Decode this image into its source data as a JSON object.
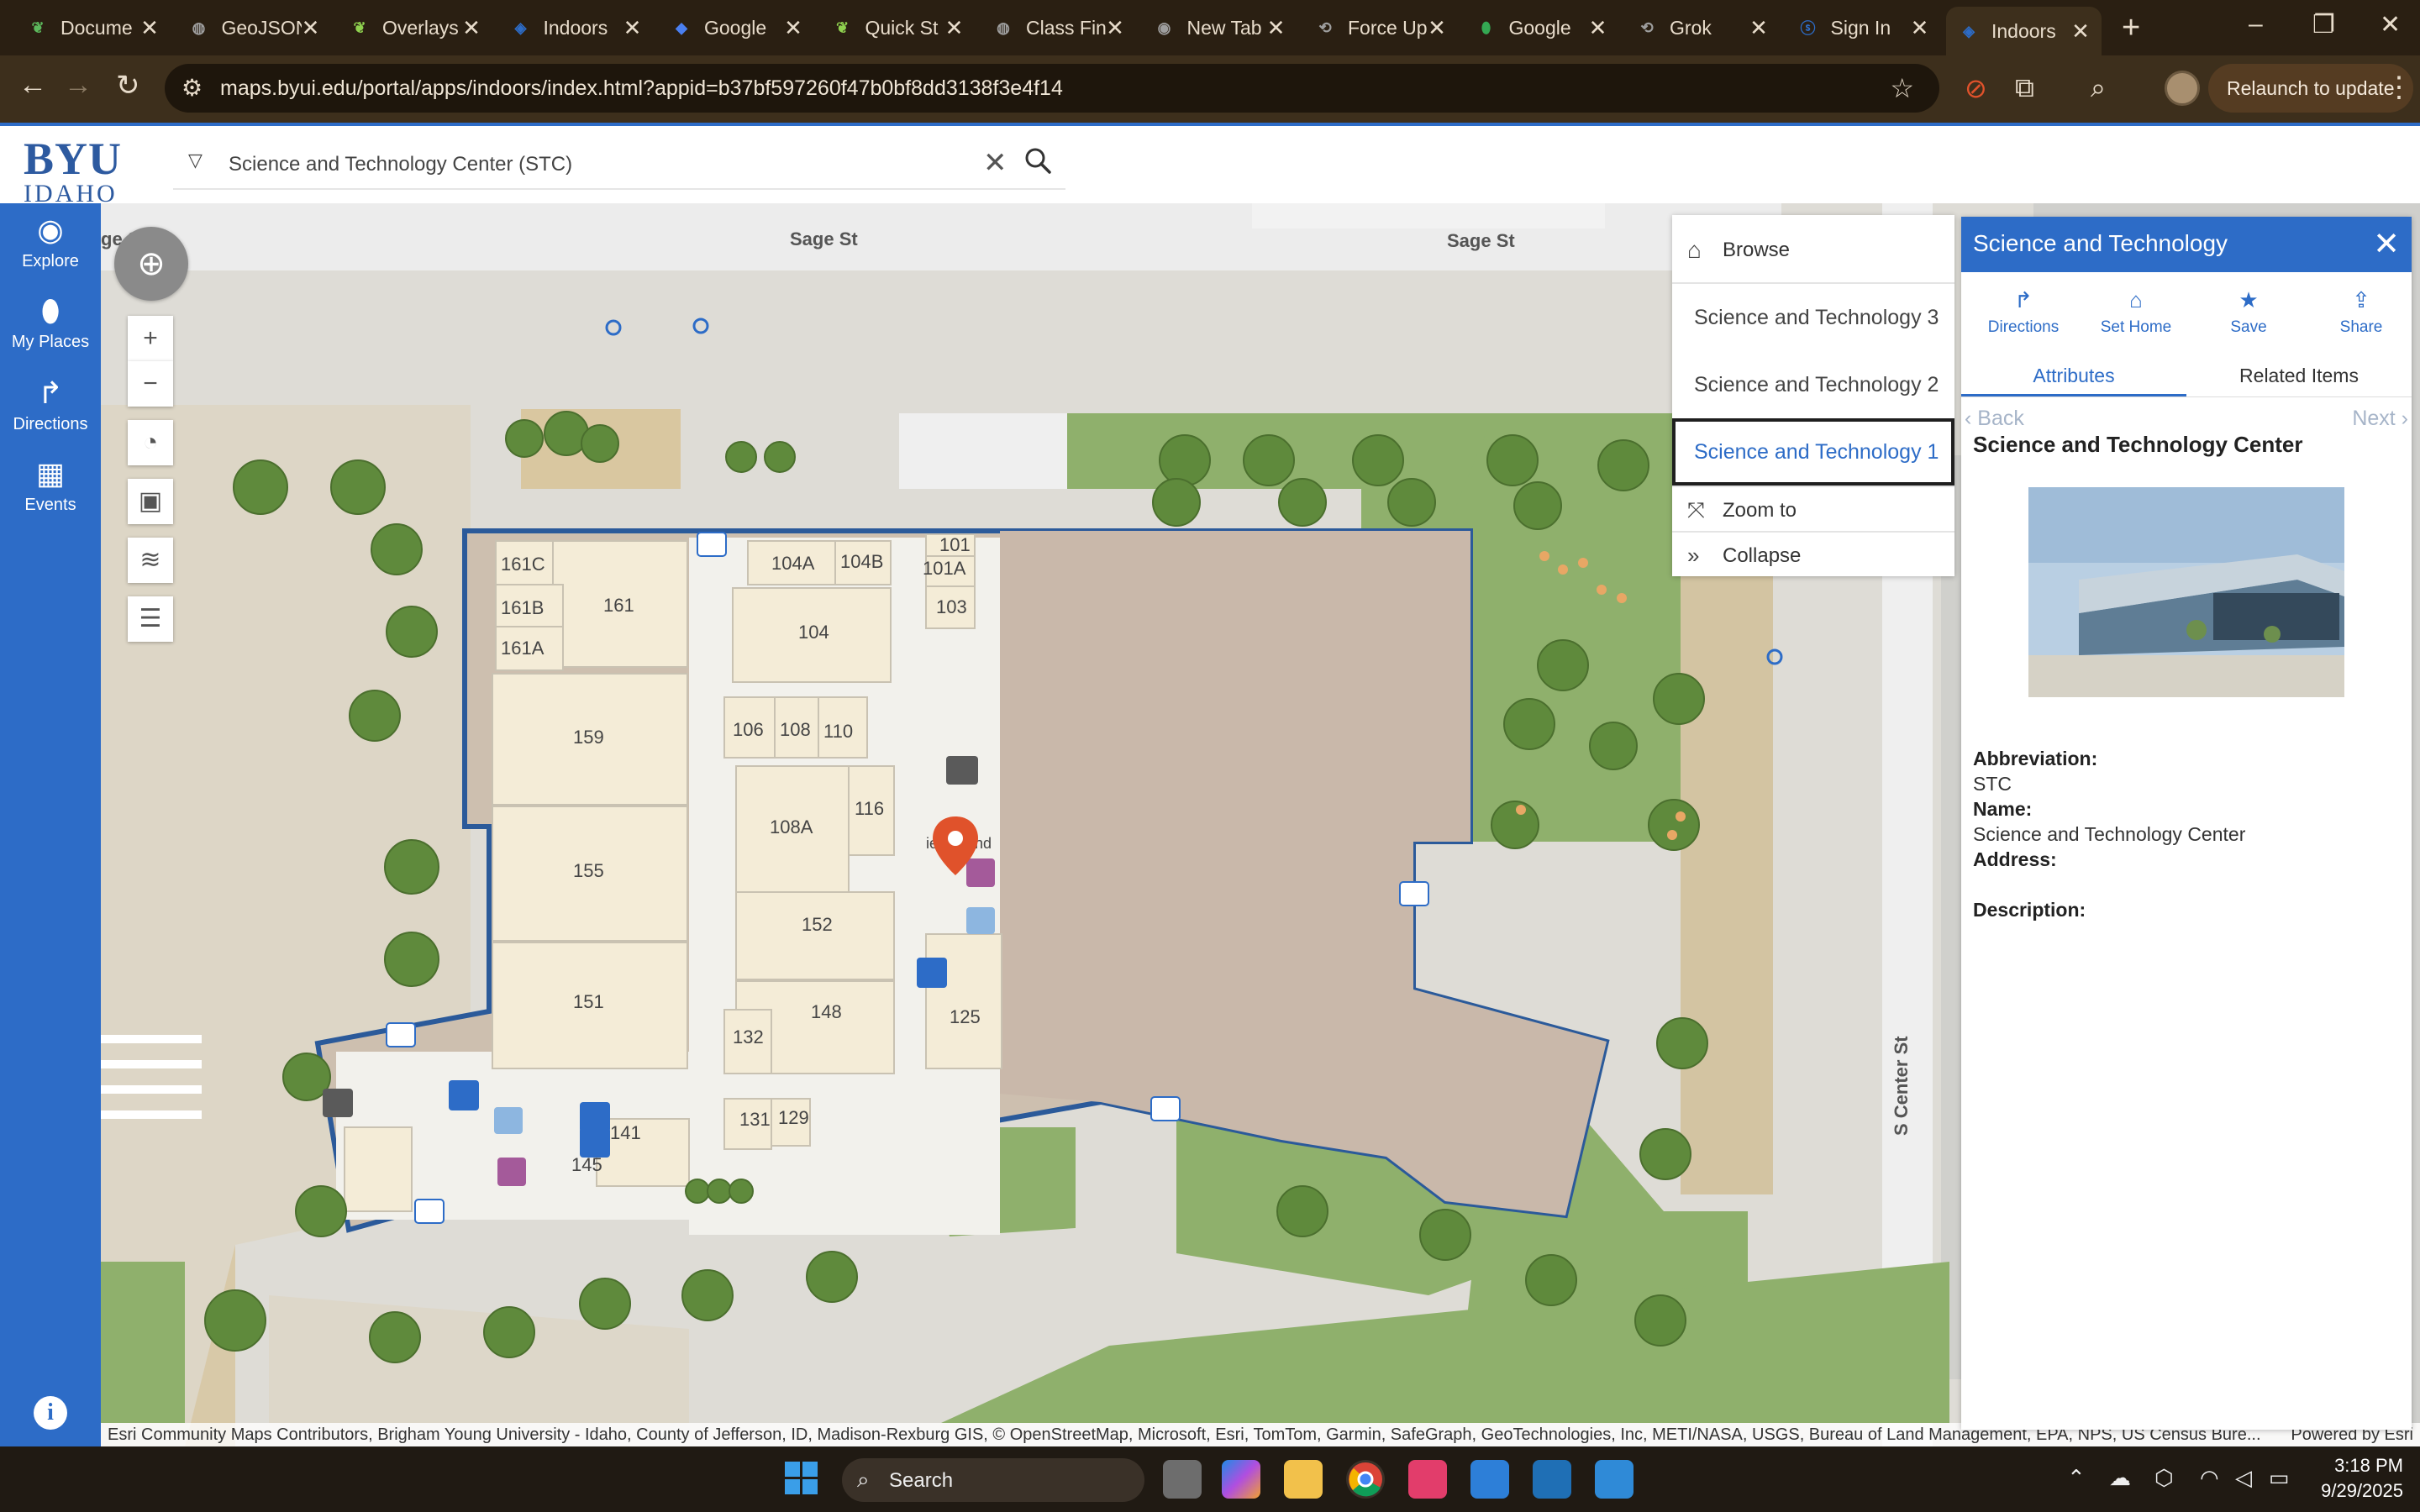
{
  "browser": {
    "tabs": [
      {
        "title": "Docume",
        "icon": "leaf-icon",
        "color": "#5cb85c"
      },
      {
        "title": "GeoJSON",
        "icon": "globe-icon",
        "color": "#9e9e9e"
      },
      {
        "title": "Overlays",
        "icon": "leaf-icon",
        "color": "#8fd14f"
      },
      {
        "title": "Indoors",
        "icon": "indoors-icon",
        "color": "#2d6cc7"
      },
      {
        "title": "Google",
        "icon": "chat-icon",
        "color": "#4a7ff0"
      },
      {
        "title": "Quick St",
        "icon": "leaf-icon",
        "color": "#8fd14f"
      },
      {
        "title": "Class Fin",
        "icon": "globe-icon",
        "color": "#9e9e9e"
      },
      {
        "title": "New Tab",
        "icon": "chrome-icon",
        "color": "#9e9e9e"
      },
      {
        "title": "Force Up",
        "icon": "link-icon",
        "color": "#9e9e9e"
      },
      {
        "title": "Google",
        "icon": "maps-pin-icon",
        "color": "#34a853"
      },
      {
        "title": "Grok",
        "icon": "link-icon",
        "color": "#9e9e9e"
      },
      {
        "title": "Sign In",
        "icon": "sign-in-icon",
        "color": "#2d6cc7"
      },
      {
        "title": "Indoors",
        "icon": "indoors-icon",
        "color": "#2d6cc7",
        "active": true
      }
    ],
    "url": "maps.byui.edu/portal/apps/indoors/index.html?appid=b37bf597260f47b0bf8dd3138f3e4f14",
    "relaunch_label": "Relaunch to update"
  },
  "header": {
    "logo_main": "BYU",
    "logo_sub": "IDAHO",
    "search_value": "Science and Technology Center (STC)"
  },
  "leftnav": {
    "items": [
      {
        "label": "Explore",
        "icon": "explore-icon"
      },
      {
        "label": "My Places",
        "icon": "pin-icon"
      },
      {
        "label": "Directions",
        "icon": "directions-icon"
      },
      {
        "label": "Events",
        "icon": "calendar-icon"
      }
    ]
  },
  "map": {
    "streets": {
      "sage_left": "ge St",
      "sage_mid": "Sage St",
      "sage_right": "Sage St",
      "center": "S Center St"
    },
    "rooms": [
      "161C",
      "161",
      "161B",
      "161A",
      "159",
      "155",
      "151",
      "104A",
      "104B",
      "104",
      "101",
      "101A",
      "103",
      "106",
      "108",
      "110",
      "108A",
      "116",
      "152",
      "148",
      "132",
      "131",
      "129",
      "125",
      "141",
      "145"
    ],
    "building_label": "ience and",
    "attribution": "Esri Community Maps Contributors, Brigham Young University - Idaho, County of Jefferson, ID, Madison-Rexburg GIS, © OpenStreetMap, Microsoft, Esri, TomTom, Garmin, SafeGraph, GeoTechnologies, Inc, METI/NASA, USGS, Bureau of Land Management, EPA, NPS, US Census Bure...",
    "powered_by": "Powered by Esri"
  },
  "floors": {
    "browse_label": "Browse",
    "items": [
      {
        "label": "Science and Technology 3",
        "selected": false
      },
      {
        "label": "Science and Technology 2",
        "selected": false
      },
      {
        "label": "Science and Technology 1",
        "selected": true
      }
    ],
    "zoom_label": "Zoom to",
    "collapse_label": "Collapse"
  },
  "detail": {
    "title": "Science and Technology",
    "actions": [
      "Directions",
      "Set Home",
      "Save",
      "Share"
    ],
    "tabs": [
      "Attributes",
      "Related Items"
    ],
    "back_label": "Back",
    "next_label": "Next",
    "name": "Science and Technology Center",
    "fields": [
      {
        "label": "Abbreviation:",
        "value": "STC"
      },
      {
        "label": "Name:",
        "value": "Science and Technology Center"
      },
      {
        "label": "Address:",
        "value": ""
      },
      {
        "label": "Description:",
        "value": ""
      }
    ]
  },
  "taskbar": {
    "search_label": "Search",
    "time": "3:18 PM",
    "date": "9/29/2025"
  },
  "colors": {
    "accent": "#2d6cc7",
    "building_outline": "#2b5a9a",
    "marker": "#e0522b"
  }
}
